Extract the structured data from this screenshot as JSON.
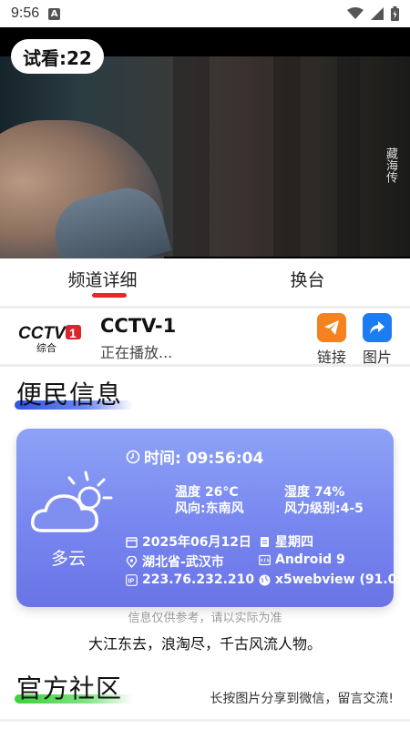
{
  "status_bar": {
    "time": "9:56",
    "notification_letter": "A"
  },
  "player": {
    "trial_text": "试看:22",
    "watermark": "藏海传"
  },
  "tabs": {
    "detail": "频道详细",
    "switch": "换台"
  },
  "channel": {
    "logo_text": "CCTV",
    "logo_number": "1",
    "logo_sub": "综合",
    "name": "CCTV-1",
    "status": "正在播放...",
    "link_label": "链接",
    "image_label": "图片"
  },
  "sections": {
    "info_title": "便民信息",
    "community_title": "官方社区"
  },
  "weather": {
    "time": "时间: 09:56:04",
    "temperature": "温度 26°C",
    "humidity": "湿度 74%",
    "wind_direction": "风向:东南风",
    "wind_level": "风力级别:4-5",
    "condition": "多云",
    "date": "2025年06月12日",
    "weekday": "星期四",
    "location": "湖北省-武汉市",
    "os": "Android 9",
    "ip": "223.76.232.210",
    "webview": "x5webview (91.0."
  },
  "disclaimer": "信息仅供参考，请以实际为准",
  "quote": "大江东去，浪淘尽，千古风流人物。",
  "share_hint": "长按图片分享到微信，留言交流!",
  "colors": {
    "tab_underline": "#e8272a",
    "link_icon_bg": "#f58220",
    "image_icon_bg": "#1e7cf2",
    "card_top": "#8ea2f6",
    "card_bottom": "#6a74e6",
    "info_highlight": "#2f55e6",
    "community_highlight": "#39d23c"
  }
}
